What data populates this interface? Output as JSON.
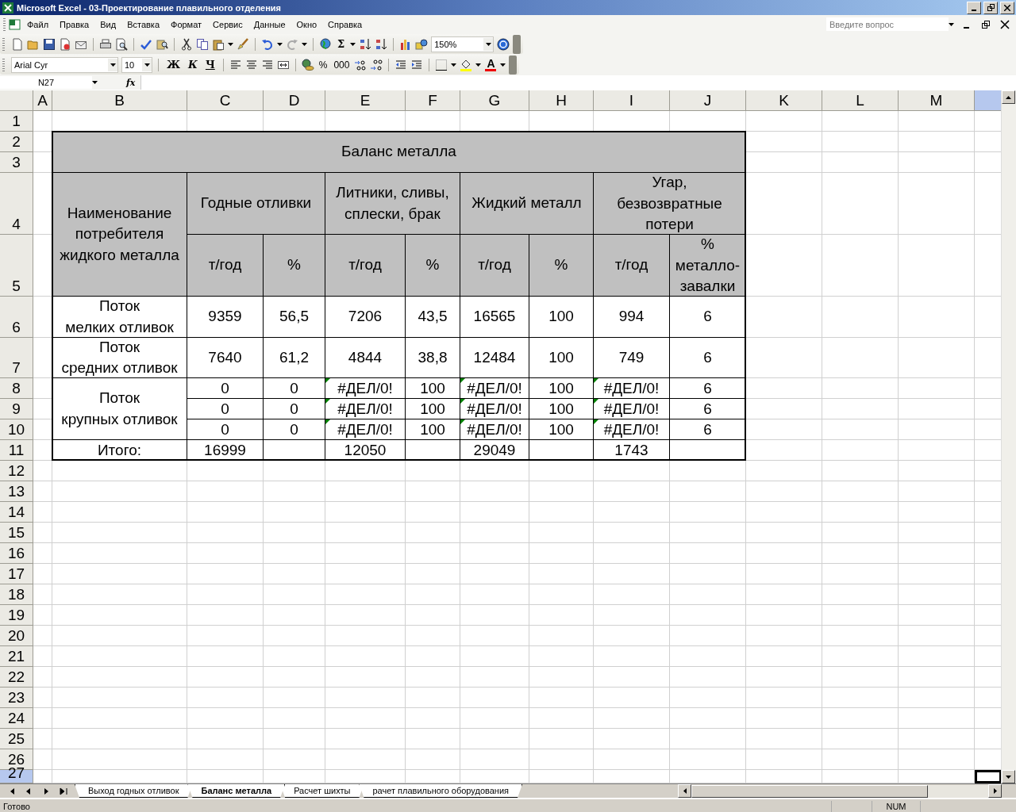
{
  "window": {
    "title": "Microsoft Excel - 03-Проектирование плавильного отделения"
  },
  "menu": {
    "items": [
      "Файл",
      "Правка",
      "Вид",
      "Вставка",
      "Формат",
      "Сервис",
      "Данные",
      "Окно",
      "Справка"
    ],
    "ask_placeholder": "Введите вопрос"
  },
  "standard_toolbar": {
    "text_buttons": [
      "Σ"
    ],
    "zoom": "150%"
  },
  "formatting_toolbar": {
    "font": "Arial Cyr",
    "size": "10",
    "text_buttons": [
      "Ж",
      "К",
      "Ч",
      "%",
      "000"
    ],
    "font_color_label": "A"
  },
  "formula_bar": {
    "name_box": "N27",
    "fx_label": "fx"
  },
  "columns": [
    {
      "label": "A",
      "selected": false
    },
    {
      "label": "B",
      "selected": false
    },
    {
      "label": "C",
      "selected": false
    },
    {
      "label": "D",
      "selected": false
    },
    {
      "label": "E",
      "selected": false
    },
    {
      "label": "F",
      "selected": false
    },
    {
      "label": "G",
      "selected": false
    },
    {
      "label": "H",
      "selected": false
    },
    {
      "label": "I",
      "selected": false
    },
    {
      "label": "J",
      "selected": false
    },
    {
      "label": "K",
      "selected": false
    },
    {
      "label": "L",
      "selected": false
    },
    {
      "label": "M",
      "selected": false
    }
  ],
  "cut_column": {
    "selected": true
  },
  "rows": [
    {
      "label": "1",
      "selected": false
    },
    {
      "label": "2",
      "selected": false
    },
    {
      "label": "3",
      "selected": false
    },
    {
      "label": "4",
      "selected": false
    },
    {
      "label": "5",
      "selected": false
    },
    {
      "label": "6",
      "selected": false
    },
    {
      "label": "7",
      "selected": false
    },
    {
      "label": "8",
      "selected": false
    },
    {
      "label": "9",
      "selected": false
    },
    {
      "label": "10",
      "selected": false
    },
    {
      "label": "11",
      "selected": false
    },
    {
      "label": "12",
      "selected": false
    },
    {
      "label": "13",
      "selected": false
    },
    {
      "label": "14",
      "selected": false
    },
    {
      "label": "15",
      "selected": false
    },
    {
      "label": "16",
      "selected": false
    },
    {
      "label": "17",
      "selected": false
    },
    {
      "label": "18",
      "selected": false
    },
    {
      "label": "19",
      "selected": false
    },
    {
      "label": "20",
      "selected": false
    },
    {
      "label": "21",
      "selected": false
    },
    {
      "label": "22",
      "selected": false
    },
    {
      "label": "23",
      "selected": false
    },
    {
      "label": "24",
      "selected": false
    },
    {
      "label": "25",
      "selected": false
    },
    {
      "label": "26",
      "selected": false
    },
    {
      "label": "27",
      "selected": true
    }
  ],
  "table": {
    "title": "Баланс металла",
    "name_header": "Наименование\nпотребителя\nжидкого металла",
    "groups": [
      {
        "label": "Годные отливки",
        "units": [
          "т/год",
          "%"
        ]
      },
      {
        "label": "Литники, сливы,\nсплески, брак",
        "units": [
          "т/год",
          "%"
        ]
      },
      {
        "label": "Жидкий металл",
        "units": [
          "т/год",
          "%"
        ]
      },
      {
        "label": "Угар,\nбезвозвратные\nпотери",
        "units": [
          "т/год",
          "%\nметалло-\nзавалки"
        ]
      }
    ],
    "rows": [
      {
        "name": "Поток\nмелких отливок",
        "lines": [
          [
            {
              "text": "9359",
              "error_mark": false
            },
            {
              "text": "56,5",
              "error_mark": false
            },
            {
              "text": "7206",
              "error_mark": false
            },
            {
              "text": "43,5",
              "error_mark": false
            },
            {
              "text": "16565",
              "error_mark": false
            },
            {
              "text": "100",
              "error_mark": false
            },
            {
              "text": "994",
              "error_mark": false
            },
            {
              "text": "6",
              "error_mark": false
            }
          ]
        ]
      },
      {
        "name": "Поток\nсредних отливок",
        "lines": [
          [
            {
              "text": "7640",
              "error_mark": false
            },
            {
              "text": "61,2",
              "error_mark": false
            },
            {
              "text": "4844",
              "error_mark": false
            },
            {
              "text": "38,8",
              "error_mark": false
            },
            {
              "text": "12484",
              "error_mark": false
            },
            {
              "text": "100",
              "error_mark": false
            },
            {
              "text": "749",
              "error_mark": false
            },
            {
              "text": "6",
              "error_mark": false
            }
          ]
        ]
      },
      {
        "name": "Поток\nкрупных отливок",
        "lines": [
          [
            {
              "text": "0",
              "error_mark": false
            },
            {
              "text": "0",
              "error_mark": false
            },
            {
              "text": "#ДЕЛ/0!",
              "error_mark": true
            },
            {
              "text": "100",
              "error_mark": false
            },
            {
              "text": "#ДЕЛ/0!",
              "error_mark": true
            },
            {
              "text": "100",
              "error_mark": false
            },
            {
              "text": "#ДЕЛ/0!",
              "error_mark": true
            },
            {
              "text": "6",
              "error_mark": false
            }
          ],
          [
            {
              "text": "0",
              "error_mark": false
            },
            {
              "text": "0",
              "error_mark": false
            },
            {
              "text": "#ДЕЛ/0!",
              "error_mark": true
            },
            {
              "text": "100",
              "error_mark": false
            },
            {
              "text": "#ДЕЛ/0!",
              "error_mark": true
            },
            {
              "text": "100",
              "error_mark": false
            },
            {
              "text": "#ДЕЛ/0!",
              "error_mark": true
            },
            {
              "text": "6",
              "error_mark": false
            }
          ],
          [
            {
              "text": "0",
              "error_mark": false
            },
            {
              "text": "0",
              "error_mark": false
            },
            {
              "text": "#ДЕЛ/0!",
              "error_mark": true
            },
            {
              "text": "100",
              "error_mark": false
            },
            {
              "text": "#ДЕЛ/0!",
              "error_mark": true
            },
            {
              "text": "100",
              "error_mark": false
            },
            {
              "text": "#ДЕЛ/0!",
              "error_mark": true
            },
            {
              "text": "6",
              "error_mark": false
            }
          ]
        ]
      },
      {
        "name": "Итого:",
        "lines": [
          [
            {
              "text": "16999",
              "error_mark": false
            },
            {
              "error_mark": false
            },
            {
              "text": "12050",
              "error_mark": false
            },
            {
              "error_mark": false
            },
            {
              "text": "29049",
              "error_mark": false
            },
            {
              "error_mark": false
            },
            {
              "text": "1743",
              "error_mark": false
            },
            {
              "error_mark": false
            }
          ]
        ]
      }
    ]
  },
  "sheet_tabs": [
    {
      "label": "Выход годных отливок",
      "selected": false
    },
    {
      "label": "Баланс металла",
      "selected": true
    },
    {
      "label": "Расчет шихты",
      "selected": false
    },
    {
      "label": "рачет плавильного оборудования",
      "selected": false
    }
  ],
  "status_bar": {
    "status": "Готово",
    "indicators": [
      "NUM"
    ]
  }
}
